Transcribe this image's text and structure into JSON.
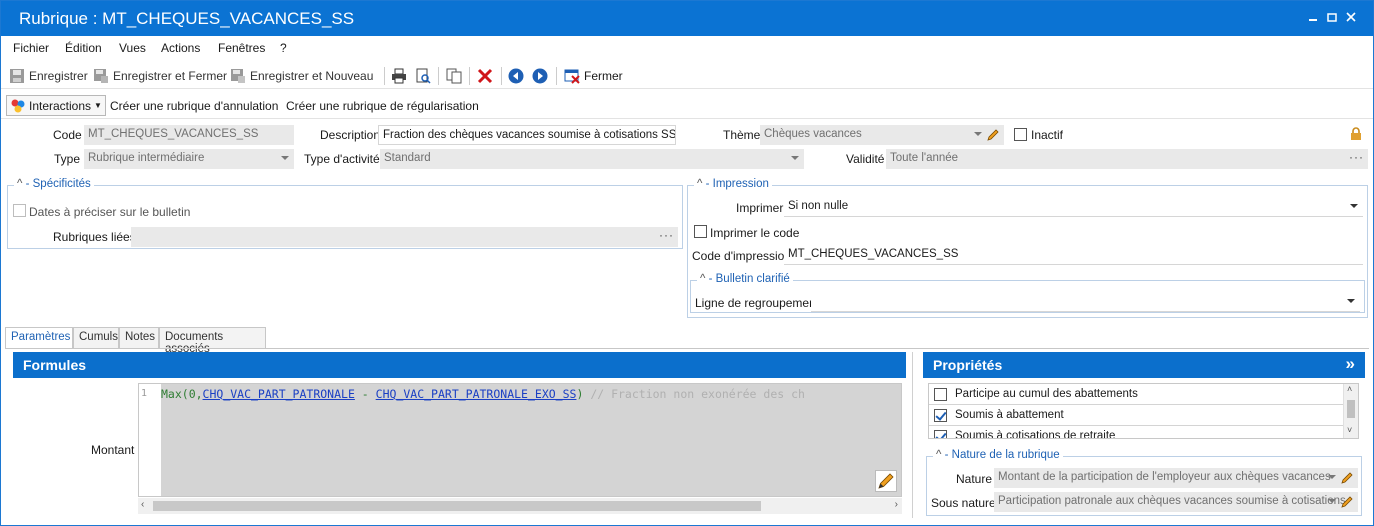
{
  "window": {
    "title": "Rubrique : MT_CHEQUES_VACANCES_SS",
    "controls": [
      "minimize-icon",
      "restore-icon",
      "close-icon"
    ]
  },
  "menu": {
    "items": [
      "Fichier",
      "Édition",
      "Vues",
      "Actions",
      "Fenêtres",
      "?"
    ]
  },
  "toolbar": {
    "save": "Enregistrer",
    "save_close": "Enregistrer et Fermer",
    "save_new": "Enregistrer et Nouveau",
    "close": "Fermer"
  },
  "actions": {
    "interactions": "Interactions",
    "create_cancel": "Créer une rubrique d'annulation",
    "create_regul": "Créer une rubrique de régularisation"
  },
  "form": {
    "code_label": "Code",
    "code_value": "MT_CHEQUES_VACANCES_SS",
    "description_label": "Description",
    "description_value": "Fraction des chèques vacances soumise à cotisations SS",
    "theme_label": "Thème",
    "theme_value": "Chèques vacances",
    "inactif_label": "Inactif",
    "type_label": "Type",
    "type_value": "Rubrique intermédiaire",
    "type_activite_label": "Type d'activité",
    "type_activite_value": "Standard",
    "validite_label": "Validité",
    "validite_value": "Toute l'année"
  },
  "specificites": {
    "title": "Spécificités",
    "dates_label": "Dates à préciser sur le bulletin",
    "rubriques_liees_label": "Rubriques liées",
    "rubriques_liees_value": ""
  },
  "impression": {
    "title": "Impression",
    "imprimer_label": "Imprimer",
    "imprimer_value": "Si non nulle",
    "imprimer_code_label": "Imprimer le code",
    "code_impression_label": "Code d'impression",
    "code_impression_value": "MT_CHEQUES_VACANCES_SS",
    "bulletin_title": "Bulletin clarifié",
    "ligne_label": "Ligne de regroupement",
    "ligne_value": ""
  },
  "tabs": [
    "Paramètres",
    "Cumuls",
    "Notes",
    "Documents associés"
  ],
  "formules": {
    "title": "Formules",
    "montant_label": "Montant",
    "line_number": "1",
    "code": {
      "fn": "Max(0,",
      "ref1": "CHQ_VAC_PART_PATRONALE",
      "op": " - ",
      "ref2": "CHQ_VAC_PART_PATRONALE_EXO_SS",
      "close": ")",
      "comment": " // Fraction non exonérée des ch"
    }
  },
  "proprietes": {
    "title": "Propriétés",
    "expand_glyph": "»",
    "items": [
      {
        "label": "Participe au cumul des abattements",
        "checked": false
      },
      {
        "label": "Soumis à abattement",
        "checked": true
      },
      {
        "label": "Soumis à cotisations de retraite",
        "checked": true
      }
    ],
    "nature_group_title": "Nature de la rubrique",
    "nature_label": "Nature",
    "nature_value": "Montant de la participation de l'employeur aux chèques vacances",
    "sous_nature_label": "Sous nature",
    "sous_nature_value": "Participation patronale aux chèques vacances soumise à cotisations"
  },
  "colors": {
    "title_bar": "#0b73d3",
    "panel_header": "#0b6fcc",
    "group_title": "#1f62b4"
  }
}
